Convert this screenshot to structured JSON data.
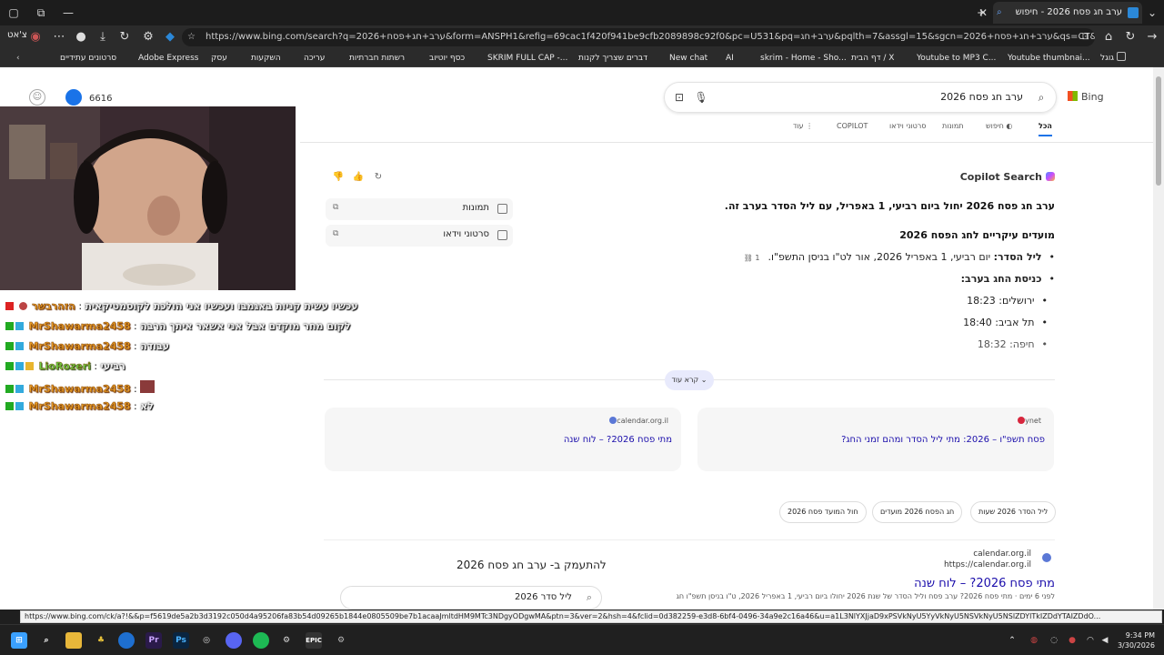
{
  "browser": {
    "active_tab_title": "ערב חג פסח 2026 - חיפוש",
    "url": "https://www.bing.com/search?q=2026+ערב+חג+פסח&form=ANSPH1&refig=69cac1f420f941be9cfb2089898c92f0&pc=U531&pq=ערב+חג&pqlth=7&assgl=15&sgcn=2026+ערב+חג+פסח&qs=CT&sgtpv=CT&smvpcn=0&swbcn...",
    "profile_label": "צ'אט",
    "bookmarks": [
      "גוגל",
      "Youtube thumbnai...",
      "Youtube to MP3 C...",
      "דף הבית / X",
      "skrim - Home - Sho...",
      "AI",
      "New chat",
      "דברים שצריך לקנות",
      "SKRIM FULL CAP -...",
      "כסף יוטיוב",
      "רשתות חברתיות",
      "עריכה",
      "השקעות",
      "עסק",
      "Adobe Express",
      "סרטונים עתידיים"
    ]
  },
  "bing": {
    "logo": "Bing",
    "query": "ערב חג פסח 2026",
    "points": "6616",
    "tabs": [
      "הכל",
      "חיפוש",
      "תמונות",
      "סרטוני וידאו",
      "COPILOT",
      "עוד"
    ],
    "copilot_header": "Copilot Search",
    "summary": "ערב חג פסח 2026 יחול ביום רביעי, 1 באפריל, עם ליל הסדר בערב זה.",
    "events_title": "מועדים עיקריים לחג הפסח 2026",
    "bullets": [
      {
        "label": "ליל הסדר:",
        "text": " יום רביעי, 1 באפריל 2026, אור לט\"ו בניסן התשפ\"ו.",
        "cite": "1"
      },
      {
        "label": "כניסת החג בערב:",
        "text": ""
      },
      {
        "label": "",
        "text": "ירושלים: 18:23"
      },
      {
        "label": "",
        "text": "תל אביב: 18:40"
      },
      {
        "label": "",
        "text": "חיפה: 18:32"
      }
    ],
    "side_cards": [
      "תמונות",
      "סרטוני וידאו"
    ],
    "read_more": "קרא עוד",
    "sources": [
      {
        "site": "ynet",
        "title": "פסח תשפ\"ו – 2026: מתי ליל הסדר ומהם זמני החג?",
        "color": "#d7263d"
      },
      {
        "site": "calendar.org.il",
        "title": "מתי פסח 2026? – לוח שנה",
        "color": "#5b78d6"
      }
    ],
    "chips": [
      "ליל הסדר 2026 שעות",
      "חג הפסח 2026 מועדים",
      "חול המועד פסח 2026"
    ],
    "result": {
      "site_name": "calendar.org.il",
      "site_url": "https://calendar.org.il",
      "title": "מתי פסח 2026? – לוח שנה",
      "snippet": "לפני 6 ימים · מתי פסח 2026? ערב פסח וליל הסדר של שנת 2026 יחולו ביום רביעי, 1 באפריל 2026, ט\"ו בניסן תשפ\"ו חג"
    },
    "deep_title": "להתעמק ב- ערב חג פסח 2026",
    "related_query": "ליל סדר 2026"
  },
  "status_url": "https://www.bing.com/ck/a?!&&p=f5619de5a2b3d3192c050d4a95206fa83b54d09265b1844e0805509be7b1acaaJmltdHM9MTc3NDgyODgwMA&ptn=3&ver=2&hsh=4&fclid=0d382259-e3d8-6bf4-0496-34a9e2c16a46&u=a1L3NlYXJjaD9xPSVkNyU5YyVkNyU5NSVkNyU5NSlZDYlTkIZDdYTAIZDdO...",
  "chat": [
    {
      "nick": "הזהרבשר",
      "msg": "עכשיו עשית קניות באגמבו ועכשיו אני הולכת לקוסמטיקאית",
      "green": false
    },
    {
      "nick": "MrShawarma2458",
      "msg": "לקום מחר מוקדם אבל אני אשאר איתך הרבה",
      "green": false
    },
    {
      "nick": "MrShawarma2458",
      "msg": "עבודה",
      "green": false
    },
    {
      "nick": "LioRozeri",
      "msg": "רביעי",
      "green": true
    },
    {
      "nick": "MrShawarma2458",
      "msg": "",
      "green": false
    },
    {
      "nick": "MrShawarma2458",
      "msg": "לא",
      "green": false
    }
  ],
  "clock": {
    "time": "9:34 PM",
    "date": "3/30/2026"
  }
}
